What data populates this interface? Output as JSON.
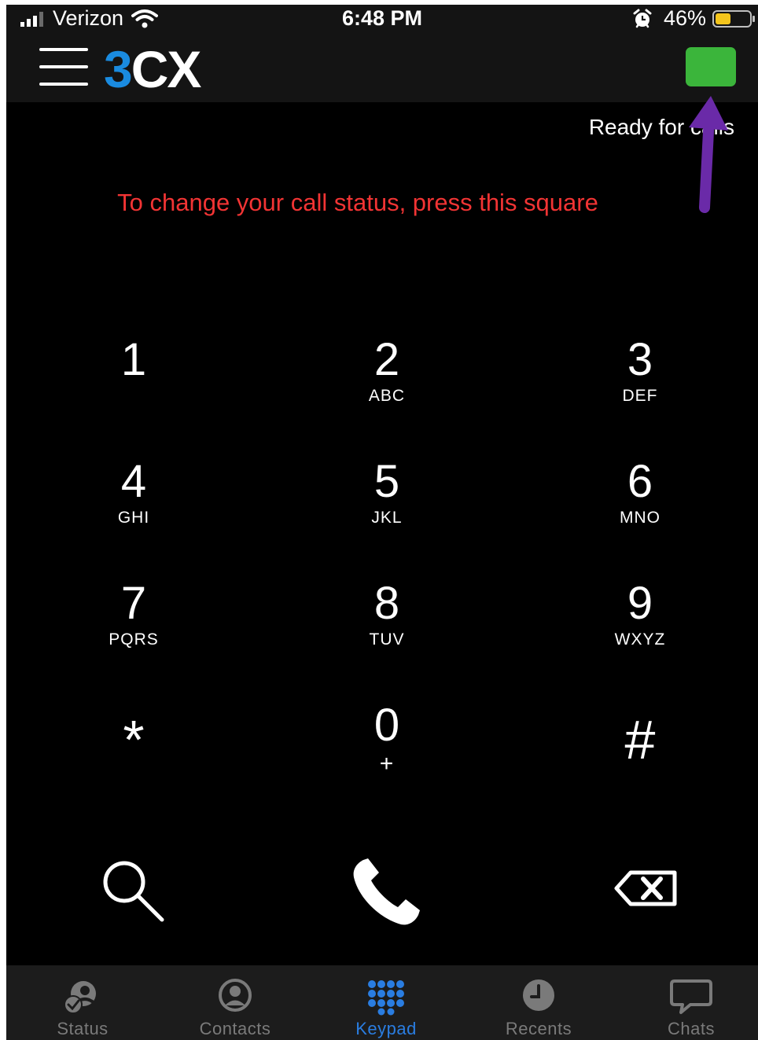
{
  "status_bar": {
    "carrier": "Verizon",
    "time": "6:48 PM",
    "battery": "46%",
    "battery_level": 0.46
  },
  "app_bar": {
    "logo_main": "3",
    "logo_rest": "CX",
    "status_color": "#3bb53b"
  },
  "presence": {
    "text": "Ready for calls"
  },
  "annotation": {
    "text": "To change your call status, press this square",
    "color": "#f23434",
    "arrow_color": "#6a2aa8"
  },
  "keypad": {
    "keys": [
      {
        "digit": "1",
        "letters": ""
      },
      {
        "digit": "2",
        "letters": "ABC"
      },
      {
        "digit": "3",
        "letters": "DEF"
      },
      {
        "digit": "4",
        "letters": "GHI"
      },
      {
        "digit": "5",
        "letters": "JKL"
      },
      {
        "digit": "6",
        "letters": "MNO"
      },
      {
        "digit": "7",
        "letters": "PQRS"
      },
      {
        "digit": "8",
        "letters": "TUV"
      },
      {
        "digit": "9",
        "letters": "WXYZ"
      },
      {
        "digit": "*",
        "letters": ""
      },
      {
        "digit": "0",
        "letters": "+"
      },
      {
        "digit": "#",
        "letters": ""
      }
    ]
  },
  "actions": {
    "search_icon": "search-icon",
    "call_icon": "phone-icon",
    "backspace_icon": "backspace-icon"
  },
  "tabs": [
    {
      "label": "Status",
      "icon": "status-icon"
    },
    {
      "label": "Contacts",
      "icon": "contact-icon"
    },
    {
      "label": "Keypad",
      "icon": "keypad-icon"
    },
    {
      "label": "Recents",
      "icon": "clock-icon"
    },
    {
      "label": "Chats",
      "icon": "chat-icon"
    }
  ],
  "colors": {
    "active_tab": "#2a7de1",
    "inactive_tab": "#7a7a7a",
    "brand_blue": "#1a8be0"
  }
}
